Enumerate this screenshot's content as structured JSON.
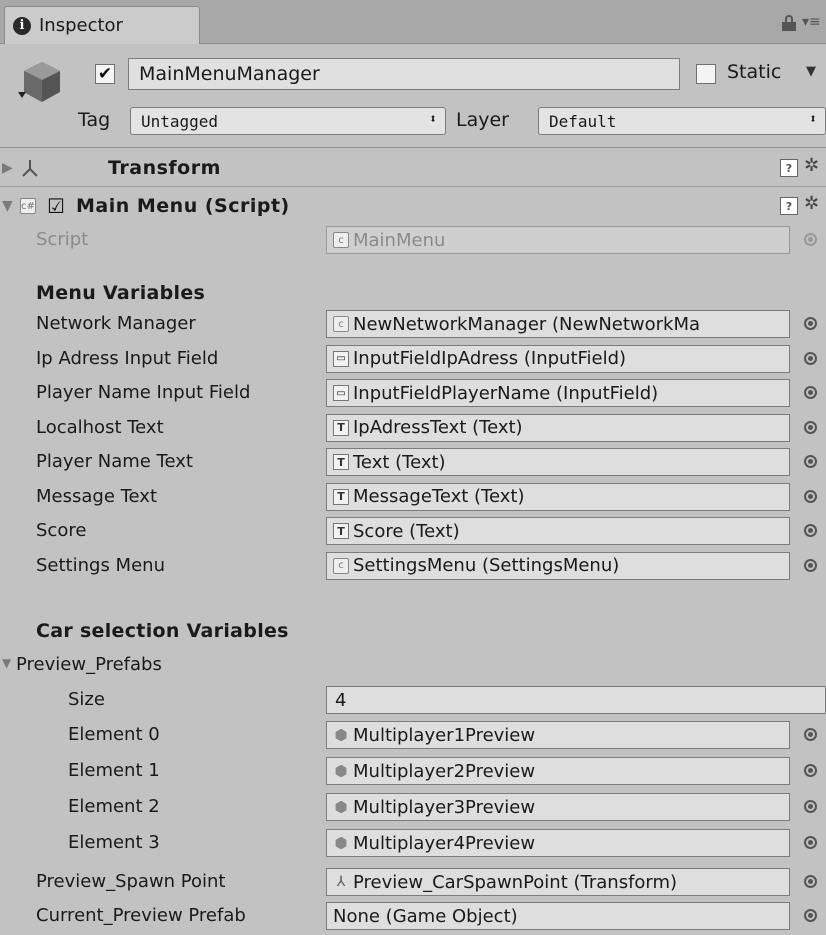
{
  "window": {
    "tab_title": "Inspector",
    "icons": [
      "info-icon",
      "lock-icon",
      "menu-icon"
    ]
  },
  "gameobject": {
    "active": true,
    "name": "MainMenuManager",
    "static_checked": false,
    "static_label": "Static",
    "tag_label": "Tag",
    "tag_value": "Untagged",
    "layer_label": "Layer",
    "layer_value": "Default"
  },
  "transform": {
    "title": "Transform",
    "expanded": false
  },
  "main_menu": {
    "title": "Main Menu (Script)",
    "enabled": true,
    "script_label": "Script",
    "script_value": "MainMenu",
    "sections": {
      "menu_variables": "Menu Variables",
      "car_selection": "Car selection Variables"
    },
    "menu_fields": [
      {
        "label": "Network Manager",
        "value": "NewNetworkManager (NewNetworkMa",
        "icon": "script"
      },
      {
        "label": "Ip Adress Input Field",
        "value": "InputFieldIpAdress (InputField)",
        "icon": "input"
      },
      {
        "label": "Player Name Input Field",
        "value": "InputFieldPlayerName (InputField)",
        "icon": "input"
      },
      {
        "label": "Localhost Text",
        "value": "IpAdressText (Text)",
        "icon": "text"
      },
      {
        "label": "Player Name Text",
        "value": "Text (Text)",
        "icon": "text"
      },
      {
        "label": "Message Text",
        "value": "MessageText  (Text)",
        "icon": "text"
      },
      {
        "label": "Score",
        "value": "Score (Text)",
        "icon": "text"
      },
      {
        "label": "Settings Menu",
        "value": "SettingsMenu (SettingsMenu)",
        "icon": "script"
      }
    ],
    "preview_prefabs": {
      "label": "Preview_Prefabs",
      "size_label": "Size",
      "size_value": "4",
      "elements": [
        {
          "label": "Element 0",
          "value": "Multiplayer1Preview"
        },
        {
          "label": "Element 1",
          "value": "Multiplayer2Preview"
        },
        {
          "label": "Element 2",
          "value": "Multiplayer3Preview"
        },
        {
          "label": "Element 3",
          "value": "Multiplayer4Preview"
        }
      ]
    },
    "spawn_point": {
      "label": "Preview_Spawn Point",
      "value": "Preview_CarSpawnPoint (Transform)"
    },
    "current_prefab": {
      "label": "Current_Preview Prefab",
      "value": "None (Game Object)"
    }
  }
}
